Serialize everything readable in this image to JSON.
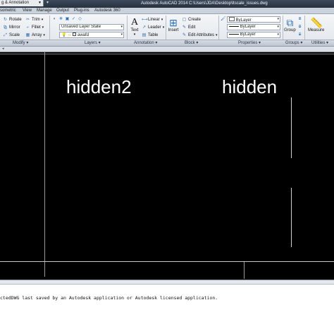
{
  "titlebar": {
    "workspace": "g & Annotation",
    "title": "Autodesk AutoCAD 2014   C:\\Users\\JDA\\Desktop\\ltscale_issues.dwg"
  },
  "tabs": [
    "sometric",
    "View",
    "Manage",
    "Output",
    "Plug-ins",
    "Autodesk 360"
  ],
  "ribbon": {
    "modify": {
      "title": "Modify",
      "tools": [
        "Rotate",
        "Trim",
        "Mirror",
        "Fillet",
        "Scale",
        "Array"
      ]
    },
    "layers": {
      "title": "Layers",
      "layer_state": "Unsaved Layer State",
      "current_layer": "awafd"
    },
    "annotation": {
      "title": "Annotation",
      "text": "Text",
      "tools": [
        "Linear",
        "Leader",
        "Table"
      ]
    },
    "block": {
      "title": "Block",
      "insert": "Insert",
      "tools": [
        "Create",
        "Edit",
        "Edit Attributes"
      ]
    },
    "properties": {
      "title": "Properties",
      "values": [
        "ByLayer",
        "ByLayer",
        "ByLayer"
      ]
    },
    "groups": {
      "title": "Groups",
      "group": "Group"
    },
    "utilities": {
      "title": "Utilities",
      "measure": "Measure"
    }
  },
  "canvas": {
    "label_left": "hidden2",
    "label_right": "hidden"
  },
  "command": {
    "message": "ctedDWG last saved by an Autodesk application or Autodesk licensed application."
  },
  "colors": {
    "canvas_bg": "#000000",
    "ribbon_bg": "#e1e6ec",
    "titlebar_bg": "#27313f"
  }
}
